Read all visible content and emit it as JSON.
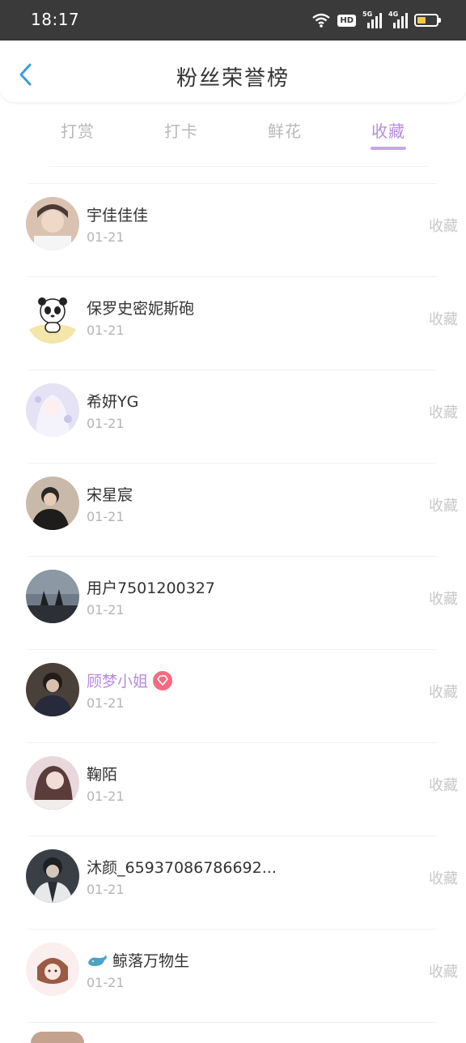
{
  "status_bar": {
    "time": "18:17",
    "hd": "HD",
    "sig1": "5G",
    "sig2": "4G"
  },
  "header": {
    "title": "粉丝荣誉榜"
  },
  "tabs": [
    {
      "label": "打赏"
    },
    {
      "label": "打卡"
    },
    {
      "label": "鲜花"
    },
    {
      "label": "收藏",
      "active": true
    }
  ],
  "list": [
    {
      "name": "宇佳佳佳",
      "date": "01-21",
      "action": "收藏"
    },
    {
      "name": "保罗史密妮斯砲",
      "date": "01-21",
      "action": "收藏"
    },
    {
      "name": "希妍YG",
      "date": "01-21",
      "action": "收藏"
    },
    {
      "name": "宋星宸",
      "date": "01-21",
      "action": "收藏"
    },
    {
      "name": "用户7501200327",
      "date": "01-21",
      "action": "收藏"
    },
    {
      "name": "顾梦小姐",
      "date": "01-21",
      "action": "收藏",
      "vip": true
    },
    {
      "name": "鞠陌",
      "date": "01-21",
      "action": "收藏"
    },
    {
      "name": "沐颜_65937086786692...",
      "date": "01-21",
      "action": "收藏"
    },
    {
      "name": "鲸落万物生",
      "date": "01-21",
      "action": "收藏"
    }
  ],
  "colors": {
    "accent": "#b78be0",
    "tab_underline": "#c8a6ea",
    "back_arrow": "#3a9de0",
    "muted_text": "#b5b5b5",
    "vip_badge": "#f36b7f"
  },
  "icons": {
    "back": "chevron-left-icon",
    "wifi": "wifi-icon",
    "battery": "battery-icon",
    "vip": "diamond-badge-icon",
    "whale": "whale-icon"
  }
}
